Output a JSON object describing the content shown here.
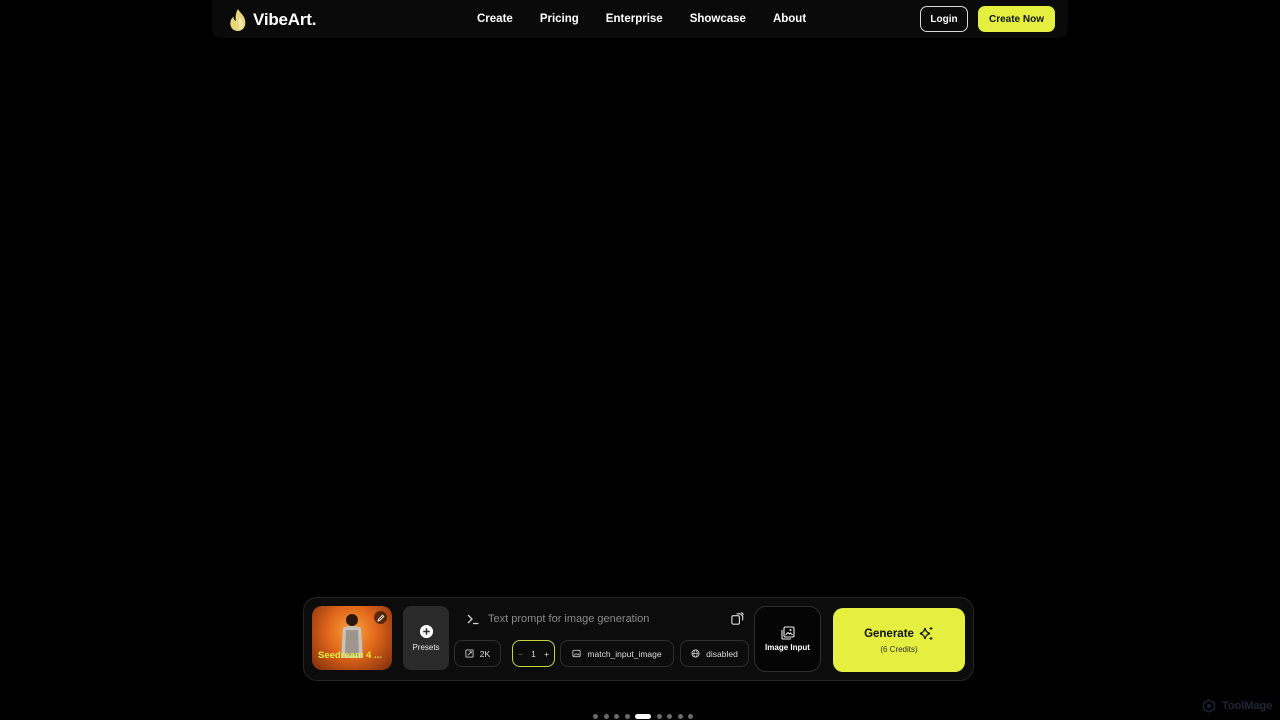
{
  "header": {
    "brand": "VibeArt.",
    "nav": [
      "Create",
      "Pricing",
      "Enterprise",
      "Showcase",
      "About"
    ],
    "login_label": "Login",
    "cta_label": "Create Now"
  },
  "composer": {
    "model": {
      "name": "Seedream 4 ...",
      "icon": "pencil-icon"
    },
    "presets_label": "Presets",
    "prompt_placeholder": "Text prompt for image generation",
    "resolution": "2K",
    "count": "1",
    "count_minus": "−",
    "count_plus": "+",
    "aspect_ratio": "match_input_image",
    "safety": "disabled",
    "image_input_label": "Image Input",
    "generate_label": "Generate",
    "generate_credits": "(6 Credits)"
  },
  "pagination": {
    "total": 9,
    "active_index": 4
  },
  "watermark": "ToolMage",
  "colors": {
    "accent": "#e4ef3f",
    "background": "#000000",
    "navbar": "#0a0a0a"
  }
}
